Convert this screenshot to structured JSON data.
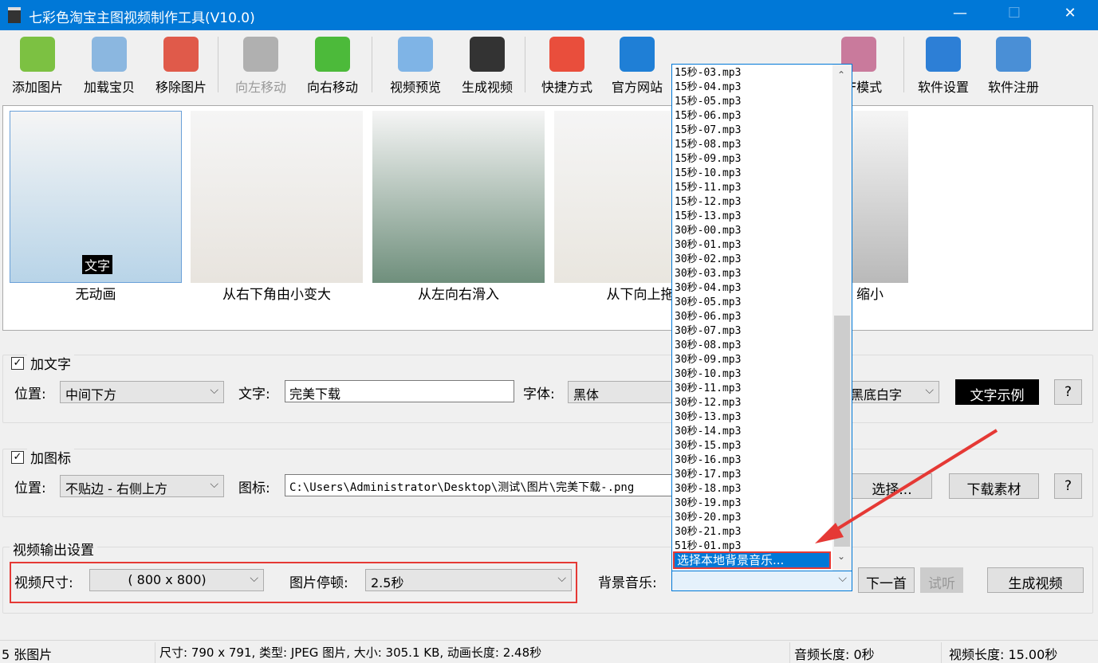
{
  "window": {
    "title": "七彩色淘宝主图视频制作工具(V10.0)",
    "minimize": "—",
    "maximize": "☐",
    "close": "✕"
  },
  "toolbar": [
    {
      "label": "添加图片",
      "icon": "add-image-icon",
      "color": "#7cc142"
    },
    {
      "label": "加载宝贝",
      "icon": "load-item-icon",
      "color": "#8bb7e0"
    },
    {
      "label": "移除图片",
      "icon": "remove-image-icon",
      "color": "#e05a4a"
    },
    {
      "label": "向左移动",
      "icon": "arrow-left-icon",
      "color": "#b0b0b0"
    },
    {
      "label": "向右移动",
      "icon": "arrow-right-icon",
      "color": "#4cba3a"
    },
    {
      "label": "视频预览",
      "icon": "magnifier-icon",
      "color": "#7fb4e6"
    },
    {
      "label": "生成视频",
      "icon": "clapperboard-icon",
      "color": "#333333"
    },
    {
      "label": "快捷方式",
      "icon": "cubes-icon",
      "color": "#e94e3c"
    },
    {
      "label": "官方网站",
      "icon": "ie-icon",
      "color": "#1f7fd6"
    },
    {
      "label": "",
      "icon": "info-icon",
      "color": "#2a6bd1"
    },
    {
      "label": "",
      "icon": "http-icon",
      "color": "#cccccc"
    },
    {
      "label": "GIF模式",
      "icon": "film-icon",
      "color": "#c97a9c"
    },
    {
      "label": "软件设置",
      "icon": "gear-icon",
      "color": "#2d7fd6"
    },
    {
      "label": "软件注册",
      "icon": "monitor-icon",
      "color": "#4a8fd6"
    }
  ],
  "thumbnails": [
    {
      "label": "无动画",
      "overlay": "文字",
      "color": "#b8d4e8"
    },
    {
      "label": "从右下角由小变大",
      "color": "#e8e4de"
    },
    {
      "label": "从左向右滑入",
      "color": "#6f8f7c"
    },
    {
      "label": "从下向上拖",
      "color": "#e9e6df"
    },
    {
      "label": "缩小",
      "color": "#b9b9b9"
    }
  ],
  "text_group": {
    "title": "加文字",
    "checked": true,
    "position_label": "位置:",
    "position_value": "中间下方",
    "text_label": "文字:",
    "text_value": "完美下载",
    "font_label": "字体:",
    "font_value": "黑体",
    "style_value": "黑底白字",
    "sample_button": "文字示例",
    "help": "?"
  },
  "icon_group": {
    "title": "加图标",
    "checked": true,
    "position_label": "位置:",
    "position_value": "不贴边 - 右侧上方",
    "icon_label": "图标:",
    "icon_path": "C:\\Users\\Administrator\\Desktop\\测试\\图片\\完美下载-.png",
    "choose_button": "选择...",
    "download_button": "下载素材",
    "help": "?"
  },
  "output": {
    "title": "视频输出设置",
    "size_label": "视频尺寸:",
    "size_value": "( 800 x  800)",
    "pause_label": "图片停顿:",
    "pause_value": "2.5秒",
    "music_label": "背景音乐:",
    "music_value": "",
    "next_button": "下一首",
    "listen_button": "试听",
    "generate_button": "生成视频"
  },
  "music_list": [
    "15秒-03.mp3",
    "15秒-04.mp3",
    "15秒-05.mp3",
    "15秒-06.mp3",
    "15秒-07.mp3",
    "15秒-08.mp3",
    "15秒-09.mp3",
    "15秒-10.mp3",
    "15秒-11.mp3",
    "15秒-12.mp3",
    "15秒-13.mp3",
    "30秒-00.mp3",
    "30秒-01.mp3",
    "30秒-02.mp3",
    "30秒-03.mp3",
    "30秒-04.mp3",
    "30秒-05.mp3",
    "30秒-06.mp3",
    "30秒-07.mp3",
    "30秒-08.mp3",
    "30秒-09.mp3",
    "30秒-10.mp3",
    "30秒-11.mp3",
    "30秒-12.mp3",
    "30秒-13.mp3",
    "30秒-14.mp3",
    "30秒-15.mp3",
    "30秒-16.mp3",
    "30秒-17.mp3",
    "30秒-18.mp3",
    "30秒-19.mp3",
    "30秒-20.mp3",
    "30秒-21.mp3",
    "51秒-01.mp3"
  ],
  "music_selected": "选择本地背景音乐...",
  "status": {
    "count": "5 张图片",
    "info": "尺寸: 790 x 791, 类型: JPEG 图片, 大小: 305.1 KB, 动画长度: 2.48秒",
    "audio": "音频长度: 0秒",
    "video": "视频长度: 15.00秒"
  },
  "colors": {
    "titlebar": "#0078d7",
    "highlight": "#0078d7",
    "annotation": "#e53935"
  }
}
